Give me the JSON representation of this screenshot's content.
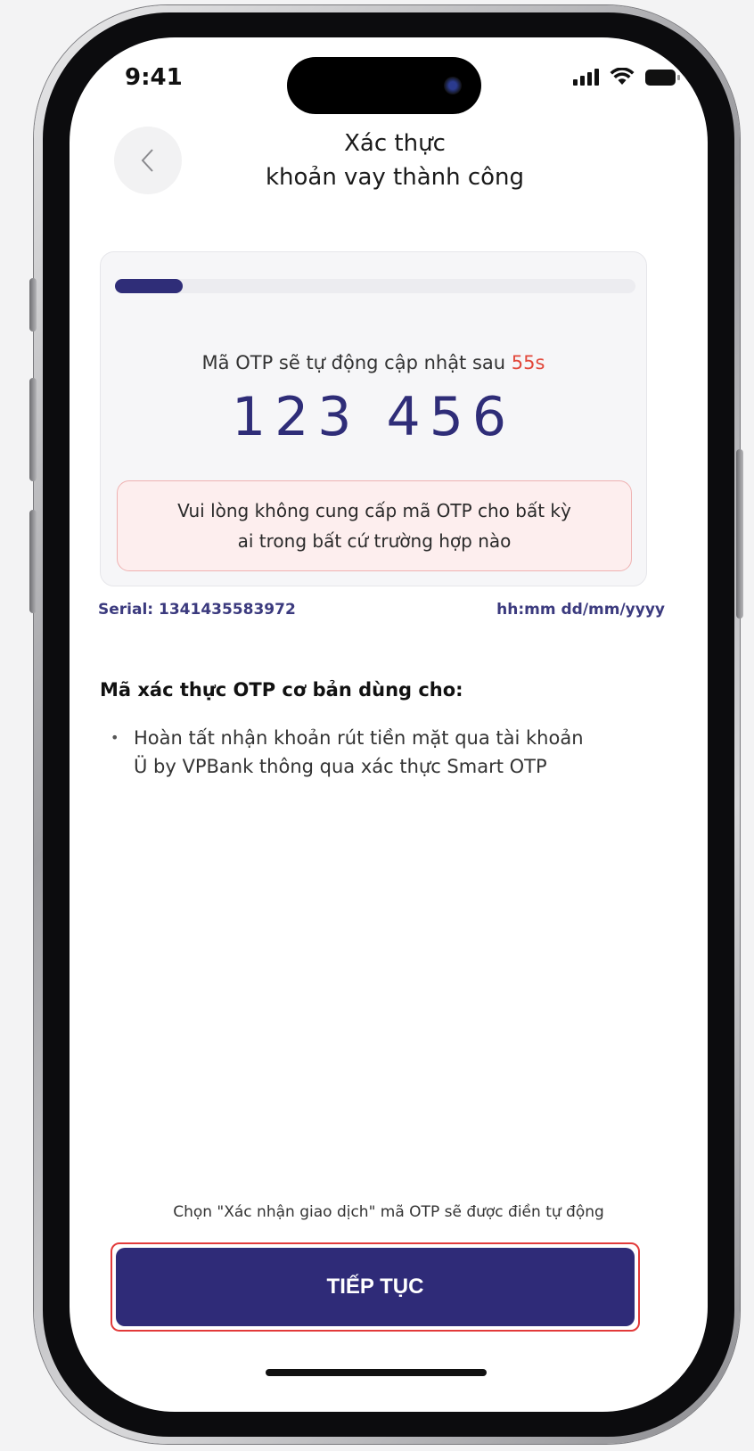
{
  "status_bar": {
    "time": "9:41"
  },
  "header": {
    "title_line1": "Xác thực",
    "title_line2": "khoản vay thành công"
  },
  "otp": {
    "countdown_prefix": "Mã OTP sẽ tự động cập nhật sau",
    "countdown_value": "55s",
    "code": "123 456",
    "progress": 0.13,
    "warning_line1": "Vui lòng không cung cấp mã OTP cho bất kỳ",
    "warning_line2": "ai trong bất cứ trường hợp nào"
  },
  "meta": {
    "serial": "Serial: 1341435583972",
    "datetime": "hh:mm dd/mm/yyyy"
  },
  "usage": {
    "title": "Mã xác thực OTP cơ bản dùng cho:",
    "items": [
      {
        "line1": "Hoàn tất nhận khoản rút tiền mặt qua tài khoản",
        "line2": "Ü by VPBank thông qua xác thực Smart OTP"
      }
    ]
  },
  "footer": {
    "hint": "Chọn \"Xác nhận giao dịch\" mã OTP sẽ được điền tự động",
    "continue_label": "TIẾP TỤC"
  },
  "colors": {
    "brand": "#2f2b78",
    "accent_red": "#e2473a",
    "warning_bg": "#fdeeee"
  },
  "icons": {
    "back": "chevron-left-icon"
  }
}
